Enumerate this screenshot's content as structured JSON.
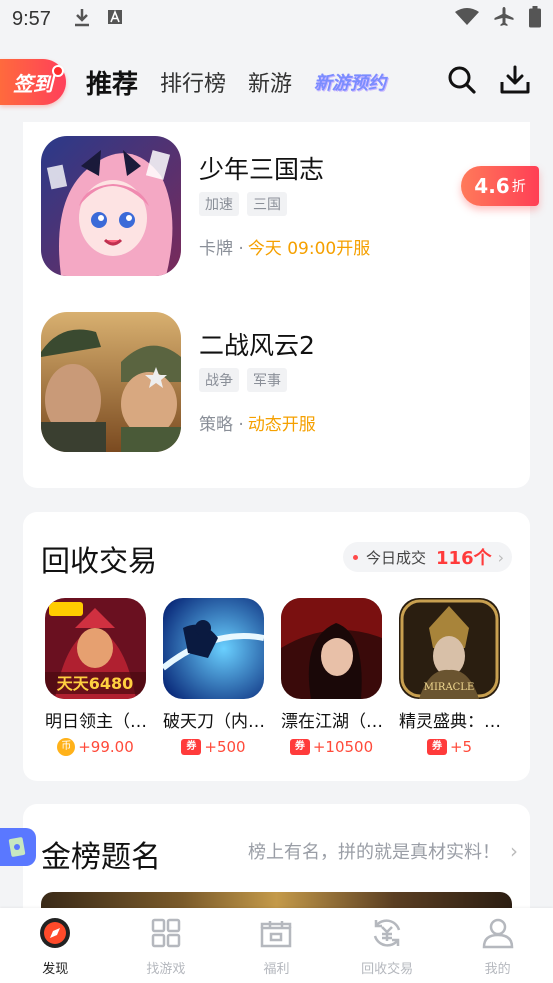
{
  "status": {
    "time": "9:57"
  },
  "nav": {
    "checkin": "签到",
    "tabs": [
      "推荐",
      "排行榜",
      "新游",
      "新游预约"
    ]
  },
  "games": [
    {
      "name": "少年三国志",
      "tags": [
        "加速",
        "三国"
      ],
      "genre": "卡牌 ·",
      "open": "今天 09:00开服",
      "discount": "4.6",
      "discount_unit": "折"
    },
    {
      "name": "二战风云2",
      "tags": [
        "战争",
        "军事"
      ],
      "genre": "策略 ·",
      "open": "动态开服"
    }
  ],
  "trade": {
    "title": "回收交易",
    "today_label": "今日成交",
    "today_count": "116个",
    "items": [
      {
        "name": "明日领主（…",
        "price": "+99.00",
        "badge": "coin",
        "badge_text": "币"
      },
      {
        "name": "破天刀（内…",
        "price": "+500",
        "badge": "coupon",
        "badge_text": "券"
      },
      {
        "name": "漂在江湖（…",
        "price": "+10500",
        "badge": "coupon",
        "badge_text": "券"
      },
      {
        "name": "精灵盛典：…",
        "price": "+5",
        "badge": "coupon",
        "badge_text": "券"
      }
    ]
  },
  "rank": {
    "title": "金榜题名",
    "subtitle": "榜上有名，拼的就是真材实料！"
  },
  "bottom_nav": [
    {
      "label": "发现",
      "icon": "compass-icon"
    },
    {
      "label": "找游戏",
      "icon": "grid-icon"
    },
    {
      "label": "福利",
      "icon": "gift-icon"
    },
    {
      "label": "回收交易",
      "icon": "recycle-icon"
    },
    {
      "label": "我的",
      "icon": "user-icon"
    }
  ],
  "colors": {
    "accent": "#ff4a3a",
    "orange": "#f5a000",
    "nav_active": "#222222"
  }
}
